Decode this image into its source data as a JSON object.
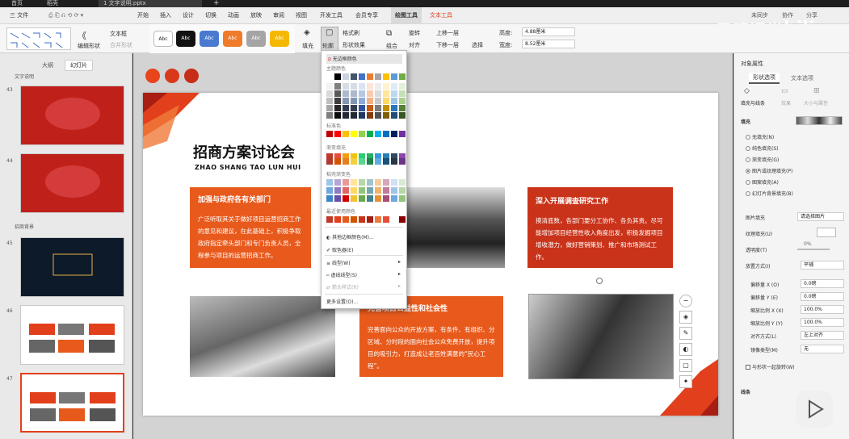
{
  "titlebar": {
    "tabs": [
      "首页",
      "稻壳",
      "1 文字说明.pptx"
    ],
    "add_tab": "+"
  },
  "menubar": {
    "file": "三 文件",
    "items": [
      "开始",
      "插入",
      "设计",
      "切换",
      "动画",
      "放映",
      "审阅",
      "视图",
      "开发工具",
      "会员专享",
      "绘图工具",
      "文本工具"
    ],
    "right": [
      "未同步",
      "协作",
      "分享"
    ]
  },
  "watermark": {
    "text": "吴明课堂"
  },
  "ribbon": {
    "edit_shape": "编辑形状",
    "textbox": "文本框",
    "merge_shape": "合并形状",
    "style_samples": [
      "Abc",
      "Abc",
      "Abc",
      "Abc",
      "Abc",
      "Abc"
    ],
    "fill": "填充",
    "outline": "轮廓",
    "format_painter": "格式刷",
    "shape_effect": "形状效果",
    "group": "组合",
    "rotate": "旋转",
    "align": "对齐",
    "up_layer": "上移一层",
    "down_layer": "下移一层",
    "select": "选择",
    "height_label": "高度:",
    "height_value": "4.88厘米",
    "width_label": "宽度:",
    "width_value": "8.52厘米"
  },
  "leftpane": {
    "tabs": [
      "大纲",
      "幻灯片"
    ],
    "section1": "文字说明",
    "section2": "招商背景",
    "slide_numbers": [
      "43",
      "44",
      "45",
      "46",
      "47"
    ]
  },
  "slide": {
    "title_cn": "招商方案讨论会",
    "title_en": "ZHAO SHANG TAO LUN HUI",
    "box1_title": "加强与政府各有关部门",
    "box1_body": "广泛听取其关于做好项目运营招商工作的意见和建议，在此基础上，积极争取政府指定牵头部门和专门负责人员，全程参与项目的运营招商工作。",
    "box2_title": "深入开展调查研究工作",
    "box2_body": "摸清底数，各部门要分工协作、各负其责。尽可能增加项目经营性收入角度出发，积极发掘项目增收潜力，做好营销策划、推广和市场测试工作。",
    "box3_title": "完善项目公益性和社会性",
    "box3_body": "完善面向公众的开放方案，有条件、有组织、分区域、分时段的面向社会公众免费开放，提升项目的吸引力，打造成让老百姓满意的“民心工程”。"
  },
  "dropdown": {
    "no_line": "无边框颜色",
    "theme_colors": "主题颜色",
    "standard_colors": "标准色",
    "gradient_fill": "渐变填充",
    "bright_gradient": "稻壳渐变色",
    "recent_colors": "最近使用颜色",
    "more_colors": "其他边框颜色(M)...",
    "eyedropper": "取色器(E)",
    "line_weight": "线型(W)",
    "dash_type": "虚线线型(S)",
    "arrow_style": "箭头样式(R)",
    "more_settings": "更多设置(O)..."
  },
  "rightpane": {
    "header": "对象属性",
    "tabs": [
      "形状选项",
      "文本选项"
    ],
    "subtabs": [
      "填充与线条",
      "效果",
      "大小与属性"
    ],
    "fill_section": "填充",
    "fill_options": [
      "无填充(N)",
      "纯色填充(S)",
      "渐变填充(G)",
      "图片或纹理填充(P)",
      "图案填充(A)",
      "幻灯片背景填充(B)"
    ],
    "selected_fill": "图片或纹理填充(P)",
    "picture_fill_label": "图片填充",
    "picture_fill_value": "请选择图片",
    "texture_label": "纹理填充(U)",
    "transparency_label": "透明度(T)",
    "transparency_value": "0%",
    "tile_label": "放置方式(I)",
    "tile_value": "平铺",
    "offset_x_label": "偏移量 X (O)",
    "offset_x_value": "0.0磅",
    "offset_y_label": "偏移量 Y (E)",
    "offset_y_value": "0.0磅",
    "scale_x_label": "缩放比例 X (X)",
    "scale_x_value": "100.0%",
    "scale_y_label": "缩放比例 Y (Y)",
    "scale_y_value": "100.0%",
    "align_label": "对齐方式(L)",
    "align_value": "左上对齐",
    "mirror_label": "镜像类型(M)",
    "mirror_value": "无",
    "rotate_with_shape": "与形状一起旋转(W)",
    "line_section": "线条"
  },
  "colors": {
    "accent_red": "#e2401c",
    "accent_orange": "#e85a1c",
    "dark_red": "#c9331a"
  }
}
